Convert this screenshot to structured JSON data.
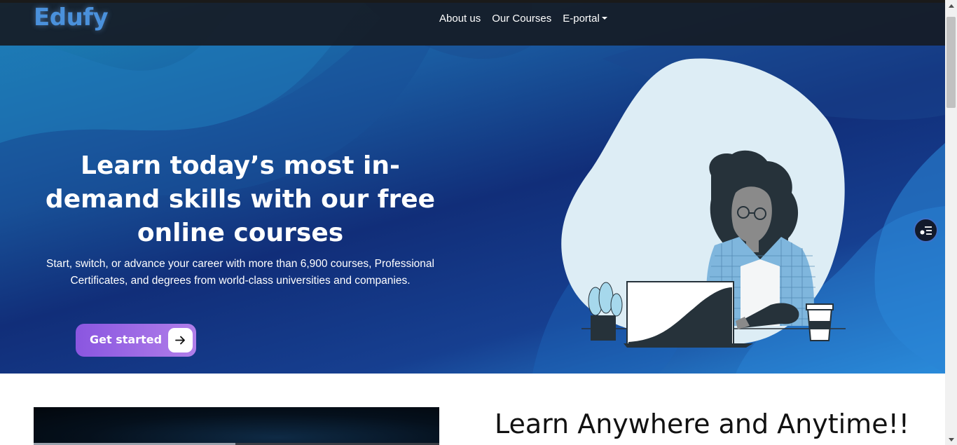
{
  "nav": {
    "brand": "Edufy",
    "links": [
      {
        "label": "About us"
      },
      {
        "label": "Our Courses"
      },
      {
        "label": "E-portal"
      }
    ]
  },
  "hero": {
    "headline": "Learn today’s most in-demand skills with our free online courses",
    "subtext": "Start, switch, or advance your career with more than 6,900 courses, Professional Certificates, and degrees from world-class universities and companies.",
    "cta_label": "Get started",
    "cta_icon": "arrow-right-icon",
    "illustration": "woman-at-laptop-illustration"
  },
  "floating_button": {
    "icon": "accessibility-menu-icon"
  },
  "section": {
    "title": "Learn Anywhere and Anytime!!"
  },
  "colors": {
    "brand": "#4a91dc",
    "nav_bg": "#161c26",
    "hero_dark": "#112e79",
    "cta_start": "#8a56e0",
    "cta_end": "#b07ee9"
  }
}
